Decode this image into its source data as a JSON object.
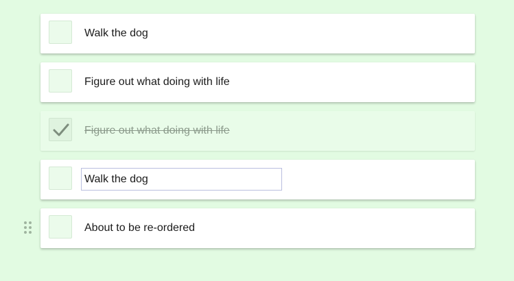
{
  "colors": {
    "background": "#e2fbe2",
    "card": "#ffffff",
    "card_done": "#e9fce9",
    "checkbox_fill": "#ebfbeb",
    "check_mark": "#7d8d7d",
    "input_border": "#b9bedf",
    "drag_dots": "#9fb49f"
  },
  "todos": [
    {
      "label": "Walk the dog",
      "checked": false
    },
    {
      "label": "Figure out what doing with life",
      "checked": false
    },
    {
      "label": "Figure out what doing with life",
      "checked": true
    },
    {
      "label": "",
      "checked": false,
      "editing": true,
      "input_value": "Walk the dog"
    },
    {
      "label": "About to be re-ordered",
      "checked": false,
      "drag_handle_icon": "drag-handle-icon"
    }
  ]
}
